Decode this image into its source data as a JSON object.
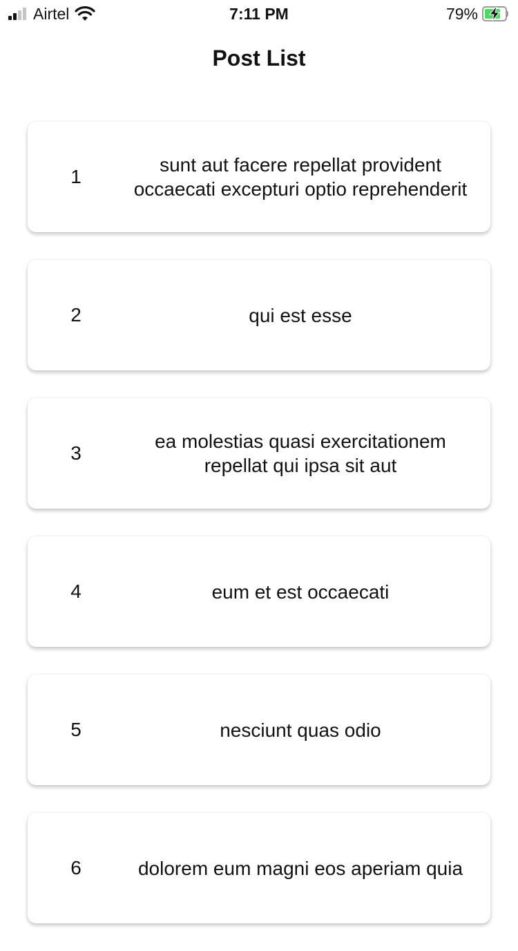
{
  "status_bar": {
    "carrier": "Airtel",
    "time": "7:11 PM",
    "battery_percent": "79%",
    "battery_level": 0.79,
    "signal_bars_filled": 2,
    "signal_bars_total": 4,
    "icons": [
      "signal-icon",
      "wifi-icon",
      "battery-icon",
      "charging-bolt-icon"
    ],
    "colors": {
      "battery_fill": "#4cd964",
      "signal_on": "#111111",
      "signal_off": "#c4c4c4"
    }
  },
  "header": {
    "title": "Post List"
  },
  "posts": [
    {
      "id": "1",
      "title": "sunt aut facere repellat provident occaecati excepturi optio reprehenderit"
    },
    {
      "id": "2",
      "title": "qui est esse"
    },
    {
      "id": "3",
      "title": "ea molestias quasi exercitationem repellat qui ipsa sit aut"
    },
    {
      "id": "4",
      "title": "eum et est occaecati"
    },
    {
      "id": "5",
      "title": "nesciunt quas odio"
    },
    {
      "id": "6",
      "title": "dolorem eum magni eos aperiam quia"
    }
  ]
}
